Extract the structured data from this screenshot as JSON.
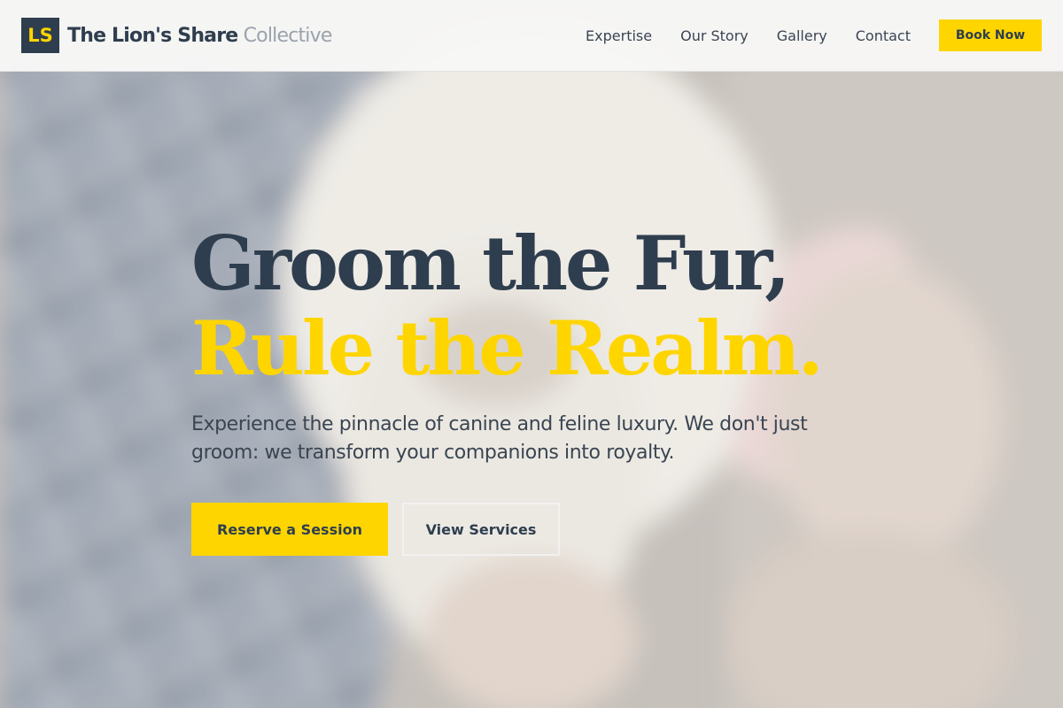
{
  "header": {
    "logo_mark": "LS",
    "brand_strong": "The Lion's Share",
    "brand_light": "Collective",
    "nav": [
      {
        "label": "Expertise"
      },
      {
        "label": "Our Story"
      },
      {
        "label": "Gallery"
      },
      {
        "label": "Contact"
      }
    ],
    "book_label": "Book Now"
  },
  "hero": {
    "headline_line1": "Groom the Fur,",
    "headline_line2": "Rule the Realm.",
    "subtext": "Experience the pinnacle of canine and feline luxury. We don't just groom: we transform your companions into royalty.",
    "primary_cta": "Reserve a Session",
    "secondary_cta": "View Services",
    "background_image": "blurred-photo-small-white-dog-plaid-blanket-grooming-brush"
  },
  "colors": {
    "accent_yellow": "#ffd500",
    "navy": "#2f3e4e",
    "brand_light_gray": "#9aa2ab"
  }
}
